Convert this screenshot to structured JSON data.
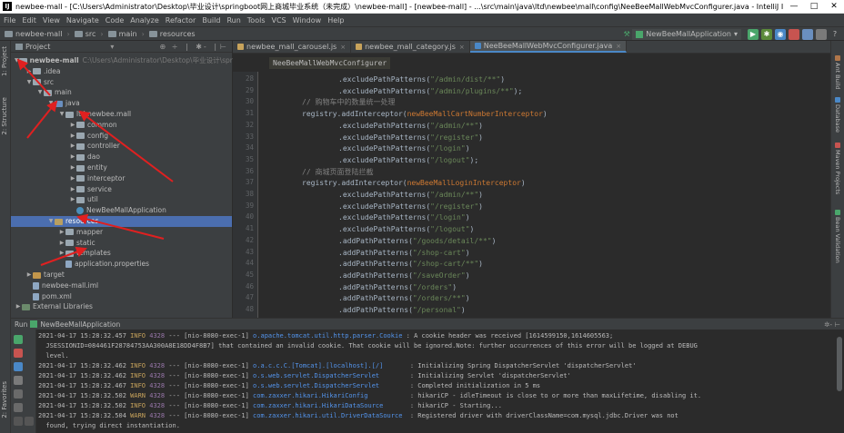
{
  "window": {
    "title": "newbee-mall - [C:\\Users\\Administrator\\Desktop\\毕业设计\\springboot网上商城毕业系统（未完成）\\newbee-mall] - [newbee-mall] - ...\\src\\main\\java\\ltd\\newbee\\mall\\config\\NeeBeeMallWebMvcConfigurer.java - IntelliJ IDEA 2016.3.8",
    "minimize": "—",
    "maximize": "□",
    "close": "✕"
  },
  "menu": [
    "File",
    "Edit",
    "View",
    "Navigate",
    "Code",
    "Analyze",
    "Refactor",
    "Build",
    "Run",
    "Tools",
    "VCS",
    "Window",
    "Help"
  ],
  "breadcrumb": [
    "newbee-mall",
    "src",
    "main",
    "resources"
  ],
  "run_config": {
    "label": "NewBeeMallApplication",
    "dropdown": "▾"
  },
  "left_tabs": [
    "1: Project",
    "2: Structure",
    "2: Favorites"
  ],
  "right_tabs": [
    "Ant Build",
    "Database",
    "Maven Projects",
    "Bean Validation"
  ],
  "project_panel": {
    "title": "Project",
    "tools": "⊕ ÷ ❘ ✱- ❘⊢",
    "tree": [
      {
        "label": "newbee-mall",
        "path": "C:\\Users\\Administrator\\Desktop\\毕业设计\\sprin",
        "icon": "module",
        "expanded": true,
        "bold": true
      },
      {
        "label": ".idea",
        "icon": "folder"
      },
      {
        "label": "src",
        "icon": "folder",
        "expanded": true
      },
      {
        "label": "main",
        "icon": "folder",
        "expanded": true
      },
      {
        "label": "java",
        "icon": "src-folder",
        "expanded": true
      },
      {
        "label": "ltd.newbee.mall",
        "icon": "package",
        "expanded": true
      },
      {
        "label": "common",
        "icon": "package"
      },
      {
        "label": "config",
        "icon": "package"
      },
      {
        "label": "controller",
        "icon": "package"
      },
      {
        "label": "dao",
        "icon": "package"
      },
      {
        "label": "entity",
        "icon": "package"
      },
      {
        "label": "interceptor",
        "icon": "package"
      },
      {
        "label": "service",
        "icon": "package"
      },
      {
        "label": "util",
        "icon": "package"
      },
      {
        "label": "NewBeeMallApplication",
        "icon": "java-class"
      },
      {
        "label": "resources",
        "icon": "resources-folder",
        "expanded": true,
        "selected": true
      },
      {
        "label": "mapper",
        "icon": "folder"
      },
      {
        "label": "static",
        "icon": "folder"
      },
      {
        "label": "templates",
        "icon": "folder"
      },
      {
        "label": "application.properties",
        "icon": "file"
      },
      {
        "label": "target",
        "icon": "target-folder"
      },
      {
        "label": "newbee-mall.iml",
        "icon": "file"
      },
      {
        "label": "pom.xml",
        "icon": "file"
      },
      {
        "label": "External Libraries",
        "icon": "library"
      }
    ]
  },
  "editor": {
    "tabs": [
      {
        "label": "newbee_mall_carousel.js",
        "active": false
      },
      {
        "label": "newbee_mall_category.js",
        "active": false
      },
      {
        "label": "NeeBeeMallWebMvcConfigurer.java",
        "active": true
      }
    ],
    "class_crumb": "NeeBeeMallWebMvcConfigurer",
    "lines": [
      {
        "n": "28",
        "indent": 2,
        "parts": [
          [
            ".excludePathPatterns(",
            "id"
          ],
          [
            "\"/admin/dist/**\"",
            "str"
          ],
          [
            ")",
            "id"
          ]
        ]
      },
      {
        "n": "29",
        "indent": 2,
        "parts": [
          [
            ".excludePathPatterns(",
            "id"
          ],
          [
            "\"/admin/plugins/**\"",
            "str"
          ],
          [
            ");",
            "id"
          ]
        ]
      },
      {
        "n": "30",
        "indent": 1,
        "parts": [
          [
            "// 购物车中的数量统一处理",
            "com"
          ]
        ]
      },
      {
        "n": "31",
        "indent": 1,
        "parts": [
          [
            "registry.addInterceptor(",
            "id"
          ],
          [
            "newBeeMallCartNumberInterceptor",
            "kw"
          ],
          [
            ")",
            "id"
          ]
        ]
      },
      {
        "n": "32",
        "indent": 2,
        "parts": [
          [
            ".excludePathPatterns(",
            "id"
          ],
          [
            "\"/admin/**\"",
            "str"
          ],
          [
            ")",
            "id"
          ]
        ]
      },
      {
        "n": "33",
        "indent": 2,
        "parts": [
          [
            ".excludePathPatterns(",
            "id"
          ],
          [
            "\"/register\"",
            "str"
          ],
          [
            ")",
            "id"
          ]
        ]
      },
      {
        "n": "34",
        "indent": 2,
        "parts": [
          [
            ".excludePathPatterns(",
            "id"
          ],
          [
            "\"/login\"",
            "str"
          ],
          [
            ")",
            "id"
          ]
        ]
      },
      {
        "n": "35",
        "indent": 2,
        "parts": [
          [
            ".excludePathPatterns(",
            "id"
          ],
          [
            "\"/logout\"",
            "str"
          ],
          [
            ");",
            "id"
          ]
        ]
      },
      {
        "n": "36",
        "indent": 1,
        "parts": [
          [
            "// 商城页面登陆拦截",
            "com"
          ]
        ]
      },
      {
        "n": "37",
        "indent": 1,
        "parts": [
          [
            "registry.addInterceptor(",
            "id"
          ],
          [
            "newBeeMallLoginInterceptor",
            "kw"
          ],
          [
            ")",
            "id"
          ]
        ]
      },
      {
        "n": "38",
        "indent": 2,
        "parts": [
          [
            ".excludePathPatterns(",
            "id"
          ],
          [
            "\"/admin/**\"",
            "str"
          ],
          [
            ")",
            "id"
          ]
        ]
      },
      {
        "n": "39",
        "indent": 2,
        "parts": [
          [
            ".excludePathPatterns(",
            "id"
          ],
          [
            "\"/register\"",
            "str"
          ],
          [
            ")",
            "id"
          ]
        ]
      },
      {
        "n": "40",
        "indent": 2,
        "parts": [
          [
            ".excludePathPatterns(",
            "id"
          ],
          [
            "\"/login\"",
            "str"
          ],
          [
            ")",
            "id"
          ]
        ]
      },
      {
        "n": "41",
        "indent": 2,
        "parts": [
          [
            ".excludePathPatterns(",
            "id"
          ],
          [
            "\"/logout\"",
            "str"
          ],
          [
            ")",
            "id"
          ]
        ]
      },
      {
        "n": "42",
        "indent": 2,
        "parts": [
          [
            ".addPathPatterns(",
            "id"
          ],
          [
            "\"/goods/detail/**\"",
            "str"
          ],
          [
            ")",
            "id"
          ]
        ]
      },
      {
        "n": "43",
        "indent": 2,
        "parts": [
          [
            ".addPathPatterns(",
            "id"
          ],
          [
            "\"/shop-cart\"",
            "str"
          ],
          [
            ")",
            "id"
          ]
        ]
      },
      {
        "n": "44",
        "indent": 2,
        "parts": [
          [
            ".addPathPatterns(",
            "id"
          ],
          [
            "\"/shop-cart/**\"",
            "str"
          ],
          [
            ")",
            "id"
          ]
        ]
      },
      {
        "n": "45",
        "indent": 2,
        "parts": [
          [
            ".addPathPatterns(",
            "id"
          ],
          [
            "\"/saveOrder\"",
            "str"
          ],
          [
            ")",
            "id"
          ]
        ]
      },
      {
        "n": "46",
        "indent": 2,
        "parts": [
          [
            ".addPathPatterns(",
            "id"
          ],
          [
            "\"/orders\"",
            "str"
          ],
          [
            ")",
            "id"
          ]
        ]
      },
      {
        "n": "47",
        "indent": 2,
        "parts": [
          [
            ".addPathPatterns(",
            "id"
          ],
          [
            "\"/orders/**\"",
            "str"
          ],
          [
            ")",
            "id"
          ]
        ]
      },
      {
        "n": "48",
        "indent": 2,
        "parts": [
          [
            ".addPathPatterns(",
            "id"
          ],
          [
            "\"/personal\"",
            "str"
          ],
          [
            ")",
            "id"
          ]
        ]
      }
    ]
  },
  "run_panel": {
    "label": "Run",
    "app": "NewBeeMallApplication",
    "tools": "✲- ⊢",
    "log": [
      {
        "ts": "2021-04-17 15:28:32.457",
        "lvl": "INFO",
        "pid": "4328",
        "thread": "--- [nio-8080-exec-1]",
        "logger": "o.apache.tomcat.util.http.parser.Cookie",
        "msg": " : A cookie header was received [1614599150,1614605563;"
      },
      {
        "raw": "  JSESSIONID=084461F28784753AA300A8E18DD4F8B7] that contained an invalid cookie. That cookie will be ignored.Note: further occurrences of this error will be logged at DEBUG"
      },
      {
        "raw": "  level."
      },
      {
        "ts": "2021-04-17 15:28:32.462",
        "lvl": "INFO",
        "pid": "4328",
        "thread": "--- [nio-8080-exec-1]",
        "logger": "o.a.c.c.C.[Tomcat].[localhost].[/]",
        "msg": "       : Initializing Spring DispatcherServlet 'dispatcherServlet'"
      },
      {
        "ts": "2021-04-17 15:28:32.462",
        "lvl": "INFO",
        "pid": "4328",
        "thread": "--- [nio-8080-exec-1]",
        "logger": "o.s.web.servlet.DispatcherServlet",
        "msg": "        : Initializing Servlet 'dispatcherServlet'"
      },
      {
        "ts": "2021-04-17 15:28:32.467",
        "lvl": "INFO",
        "pid": "4328",
        "thread": "--- [nio-8080-exec-1]",
        "logger": "o.s.web.servlet.DispatcherServlet",
        "msg": "        : Completed initialization in 5 ms"
      },
      {
        "ts": "2021-04-17 15:28:32.502",
        "lvl": "WARN",
        "pid": "4328",
        "thread": "--- [nio-8080-exec-1]",
        "logger": "com.zaxxer.hikari.HikariConfig",
        "msg": "           : hikariCP - idleTimeout is close to or more than maxLifetime, disabling it."
      },
      {
        "ts": "2021-04-17 15:28:32.502",
        "lvl": "INFO",
        "pid": "4328",
        "thread": "--- [nio-8080-exec-1]",
        "logger": "com.zaxxer.hikari.HikariDataSource",
        "msg": "       : hikariCP - Starting..."
      },
      {
        "ts": "2021-04-17 15:28:32.504",
        "lvl": "WARN",
        "pid": "4328",
        "thread": "--- [nio-8080-exec-1]",
        "logger": "com.zaxxer.hikari.util.DriverDataSource",
        "msg": "  : Registered driver with driverClassName=com.mysql.jdbc.Driver was not"
      },
      {
        "raw": "  found, trying direct instantiation."
      }
    ]
  },
  "colors": {
    "annotation_arrow": "#e02020",
    "selection": "#4b6eaf"
  }
}
